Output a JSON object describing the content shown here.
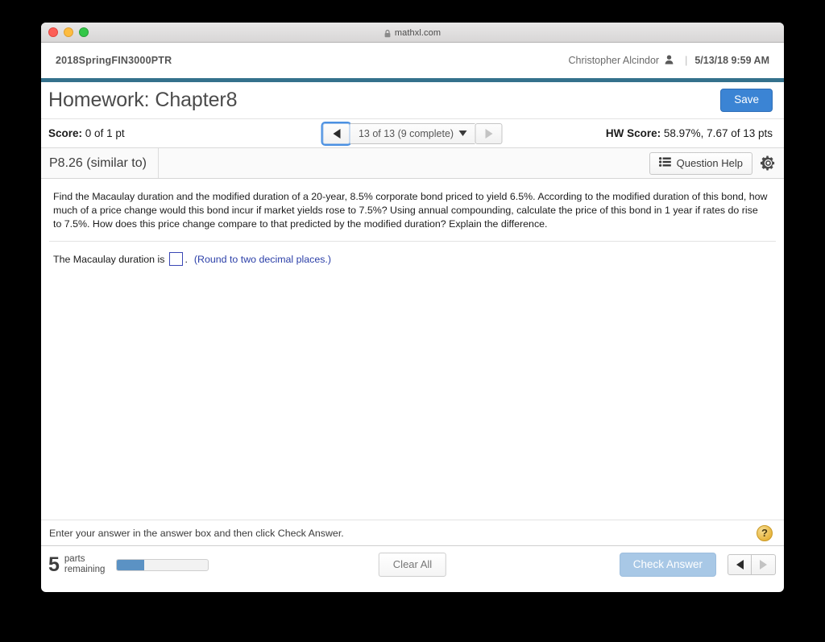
{
  "browser": {
    "url": "mathxl.com",
    "lock_icon": "lock-icon",
    "traffic_lights": [
      "close",
      "minimize",
      "zoom"
    ]
  },
  "site_header": {
    "course_code": "2018SpringFIN3000PTR",
    "user_name": "Christopher Alcindor",
    "user_icon": "person-icon",
    "separator": "|",
    "timestamp": "5/13/18 9:59 AM"
  },
  "assignment": {
    "title": "Homework: Chapter8",
    "save_label": "Save"
  },
  "score_bar": {
    "score_label": "Score:",
    "score_value": "0 of 1 pt",
    "prev_icon": "triangle-left-icon",
    "next_icon": "triangle-right-icon",
    "pager_value": "13 of 13 (9 complete)",
    "pager_caret": "chevron-down-icon",
    "hw_score_label": "HW Score:",
    "hw_score_value": "58.97%, 7.67 of 13 pts"
  },
  "problem_header": {
    "problem_id": "P8.26 (similar to)",
    "question_help_label": "Question Help",
    "question_help_icon": "list-icon",
    "settings_icon": "gear-icon"
  },
  "question": {
    "text": "Find the Macaulay duration and the modified duration of a 20-year, 8.5% corporate bond priced to yield 6.5%.  According to the modified duration of this bond, how much of a price change would this bond incur if market yields rose to 7.5%? Using annual compounding, calculate the price of this bond in 1 year if rates do rise to 7.5%.  How does this price change compare to that predicted by the modified duration? Explain the difference.",
    "answer_prompt": "The Macaulay duration is",
    "answer_value": "",
    "answer_period": ".",
    "rounding_hint": "(Round to two decimal places.)"
  },
  "footer": {
    "enter_instruction": "Enter your answer in the answer box and then click Check Answer.",
    "help_icon": "question-mark-icon",
    "parts_count": "5",
    "parts_label_line1": "parts",
    "parts_label_line2": "remaining",
    "progress_percent": 30,
    "clear_all_label": "Clear All",
    "check_answer_label": "Check Answer",
    "prev_icon": "triangle-left-icon",
    "next_icon": "triangle-right-icon"
  },
  "colors": {
    "accent_blue": "#3b84d4",
    "teal_rule": "#34718c",
    "progress_blue": "#5b92c4",
    "hint_blue": "#2b3fa8",
    "help_gold": "#e8b63f"
  }
}
